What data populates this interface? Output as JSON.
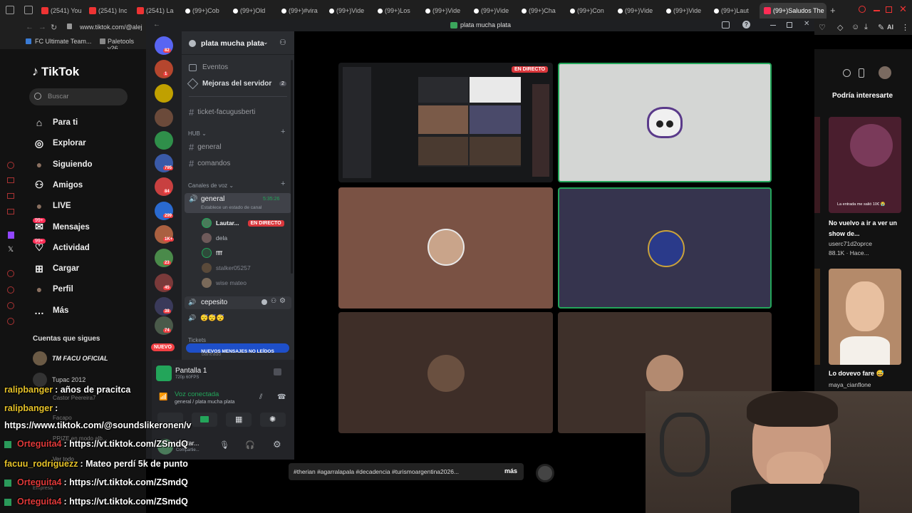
{
  "browser": {
    "tabs": [
      {
        "label": "(2541) You",
        "color": "#e33"
      },
      {
        "label": "(2541) Inc",
        "color": "#e33"
      },
      {
        "label": "(2541) La",
        "color": "#e33"
      },
      {
        "label": "(99+)Cob",
        "color": "#fff"
      },
      {
        "label": "(99+)Old",
        "color": "#fff"
      },
      {
        "label": "(99+)#vira",
        "color": "#fff"
      },
      {
        "label": "(99+)Vide",
        "color": "#fff"
      },
      {
        "label": "(99+)Los",
        "color": "#fff"
      },
      {
        "label": "(99+)Vide",
        "color": "#fff"
      },
      {
        "label": "(99+)Vide",
        "color": "#fff"
      },
      {
        "label": "(99+)Cha",
        "color": "#fff"
      },
      {
        "label": "(99+)Con",
        "color": "#fff"
      },
      {
        "label": "(99+)Vide",
        "color": "#fff"
      },
      {
        "label": "(99+)Vide",
        "color": "#fff"
      },
      {
        "label": "(99+)Laut",
        "color": "#fff"
      }
    ],
    "active_tab": "(99+)Saludos The",
    "url": "www.tiktok.com/@alej",
    "bookmarks": [
      "FC Ultimate Team...",
      "Paletools v26."
    ]
  },
  "tiktok": {
    "logo": "TikTok",
    "search_placeholder": "Buscar",
    "nav": [
      {
        "label": "Para ti",
        "icon": "home-icon"
      },
      {
        "label": "Explorar",
        "icon": "compass-icon"
      },
      {
        "label": "Siguiendo",
        "icon": "avatar-icon"
      },
      {
        "label": "Amigos",
        "icon": "friends-icon"
      },
      {
        "label": "LIVE",
        "icon": "live-icon"
      },
      {
        "label": "Mensajes",
        "icon": "message-icon"
      },
      {
        "label": "Actividad",
        "icon": "activity-icon"
      },
      {
        "label": "Cargar",
        "icon": "upload-icon"
      },
      {
        "label": "Perfil",
        "icon": "profile-icon"
      },
      {
        "label": "Más",
        "icon": "more-icon"
      }
    ],
    "badges": {
      "mensajes": "99+",
      "actividad": "99+"
    },
    "following_header": "Cuentas que sigues",
    "following": [
      "TM FACU OFICIAL",
      "Tupac 2012",
      "Castor Peereira7",
      "Facapo",
      "PRIZE en modo alb..."
    ],
    "see_all": "Ver todo",
    "company": "Empresa",
    "right_header": "Podría interesarte",
    "recommendations": [
      {
        "caption": "No vuelvo a ir a ver un show de...",
        "user": "userc71d2oprce",
        "meta": "88.1K · Hace...",
        "overlay": "La entrada me salió 10€ 😭"
      },
      {
        "caption": "Lo dovevo fare 😅",
        "user": "maya_cianflone",
        "meta": "",
        "overlay": ""
      }
    ],
    "video_caption": "#therian #agarralapala #decadencia #turismoargentina2026...",
    "more_label": "más"
  },
  "discord": {
    "window_title": "plata mucha plata",
    "server_name": "plata mucha plata",
    "guild_badges": [
      "82",
      "1",
      "795",
      "84",
      "299",
      "1K+",
      "23",
      "45",
      "38",
      "74"
    ],
    "new_label": "NUEVO",
    "top_items": [
      {
        "label": "Eventos",
        "icon": "calendar-icon"
      },
      {
        "label": "Mejoras del servidor",
        "count": "2",
        "icon": "boost-icon"
      }
    ],
    "channel_ticket": "ticket-facugusberti",
    "category_hub": "HUB",
    "hub_channels": [
      "general",
      "comandos"
    ],
    "category_voice": "Canales de voz",
    "voice_channel": {
      "name": "general",
      "status": "Establece un estado de canal",
      "time": "5:35:26"
    },
    "voice_users": [
      {
        "name": "Lautar...",
        "live": "EN DIRECTO"
      },
      {
        "name": "dela",
        "live": ""
      },
      {
        "name": "ffff",
        "live": ""
      },
      {
        "name": "stalker05257",
        "live": ""
      },
      {
        "name": "wise mateo",
        "live": ""
      }
    ],
    "voice_channel_2": "cepesito",
    "voice2_emojis": "😴😴😴",
    "category_tickets": "Tickets",
    "new_messages": "NUEVOS MENSAJES NO LEÍDOS",
    "hidden_channel": "baneado",
    "screen_share": {
      "title": "Pantalla 1",
      "info": "720p 60FPS"
    },
    "voice_connected": {
      "status": "Voz conectada",
      "channel": "general / plata mucha plata"
    },
    "user": {
      "name": "Lautar...",
      "sub": "Compartie..."
    },
    "live_badge": "EN DIRECTO",
    "colors": {
      "green": "#23a55a",
      "red": "#da373c",
      "blurple": "#5865f2"
    }
  },
  "chat": [
    {
      "name": "ralipbanger",
      "msg": ": años de pracitca",
      "style": "yellow"
    },
    {
      "name": "ralipbanger",
      "msg": ":",
      "style": "yellow"
    },
    {
      "name": "",
      "msg": "https://www.tiktok.com/@soundslikeronen/v",
      "style": "plain"
    },
    {
      "name": "Orteguita4",
      "msg": ": https://vt.tiktok.com/ZSmdQ",
      "style": "red"
    },
    {
      "name": "facuu_rodriguezz",
      "msg": ": Mateo perdí 5k de punto",
      "style": "yellow"
    },
    {
      "name": "Orteguita4",
      "msg": ": https://vt.tiktok.com/ZSmdQ",
      "style": "red"
    },
    {
      "name": "Orteguita4",
      "msg": ": https://vt.tiktok.com/ZSmdQ",
      "style": "red"
    }
  ]
}
